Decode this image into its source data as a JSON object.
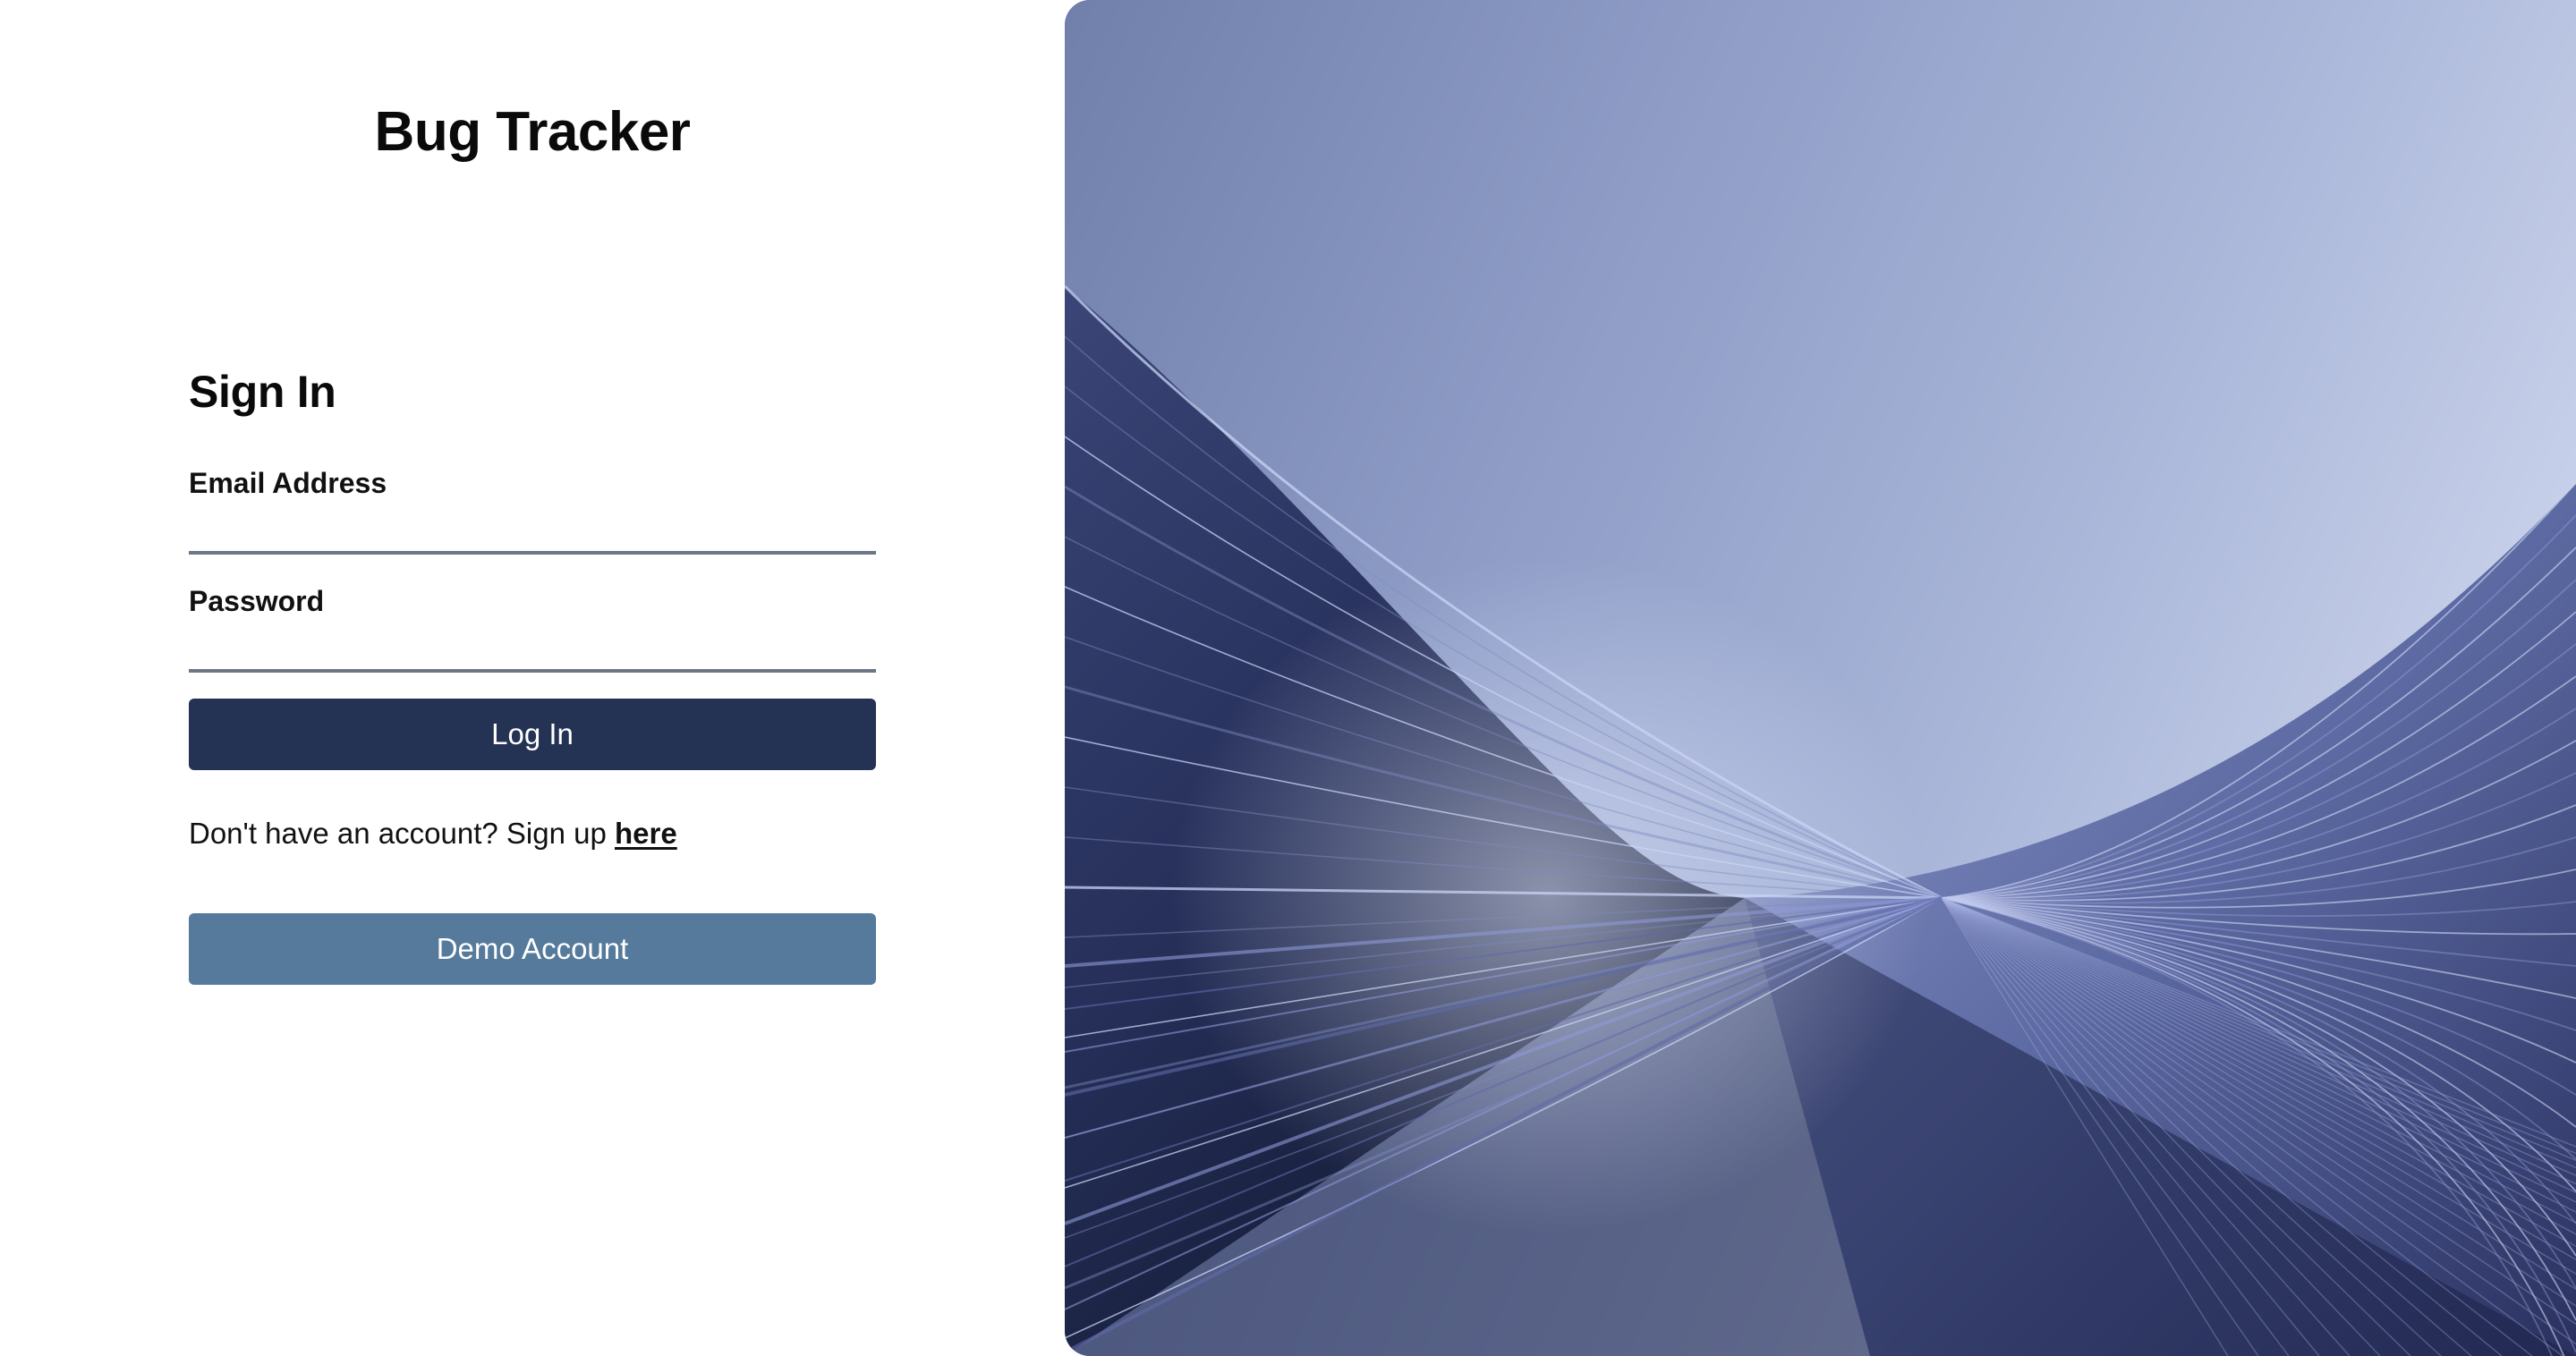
{
  "app": {
    "title": "Bug Tracker"
  },
  "form": {
    "heading": "Sign In",
    "email_label": "Email Address",
    "email_value": "",
    "password_label": "Password",
    "password_value": "",
    "login_button": "Log In",
    "signup_prompt": "Don't have an account? Sign up ",
    "signup_link": "here",
    "demo_button": "Demo Account"
  },
  "colors": {
    "login_button": "#243353",
    "demo_button": "#557a9b",
    "input_underline": "#6b7686"
  },
  "hero": {
    "image": "abstract-wave-lines"
  }
}
